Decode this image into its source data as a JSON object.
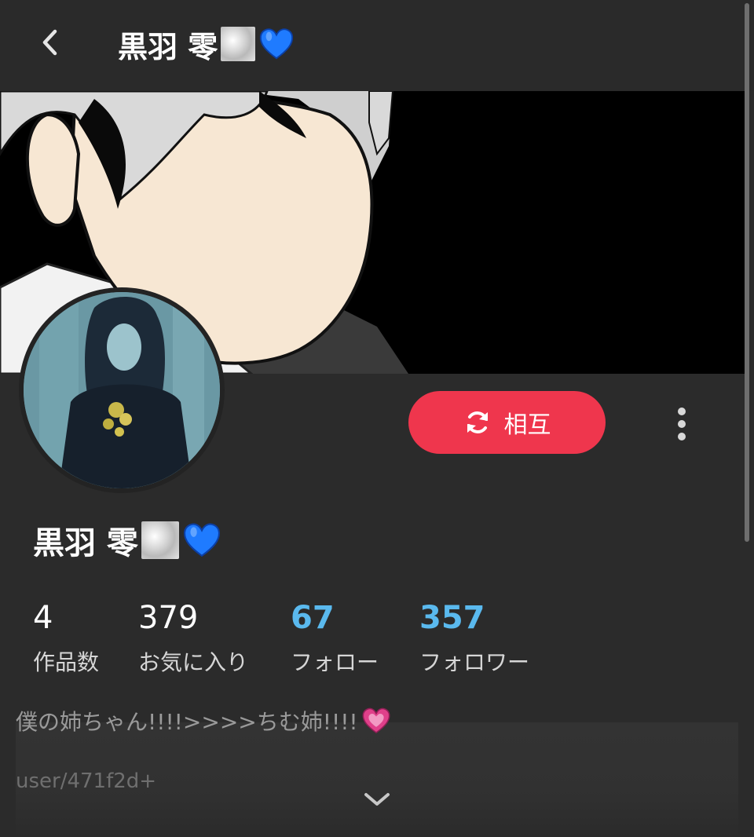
{
  "header": {
    "title": "黒羽 零",
    "back_icon": "chevron-left-icon"
  },
  "profile": {
    "display_name": "黒羽 零",
    "mutual_button_label": "相互",
    "mutual_icon": "refresh-icon",
    "more_icon": "more-vertical-icon"
  },
  "stats": {
    "works": {
      "value": "4",
      "label": "作品数"
    },
    "favorites": {
      "value": "379",
      "label": "お気に入り"
    },
    "following": {
      "value": "67",
      "label": "フォロー"
    },
    "followers": {
      "value": "357",
      "label": "フォロワー"
    }
  },
  "bio": {
    "text": "僕の姉ちゃん!!!!>>>>ちむ姉!!!!",
    "link_partial": "user/471f2d+"
  },
  "colors": {
    "accent_button": "#ef364d",
    "stat_link_blue": "#5ab9ee",
    "background": "#2b2b2b"
  },
  "icons": {
    "expand": "chevron-down-icon",
    "emoji_heart_blue": "blue-heart-icon",
    "emoji_heart_pink": "growing-heart-icon"
  }
}
